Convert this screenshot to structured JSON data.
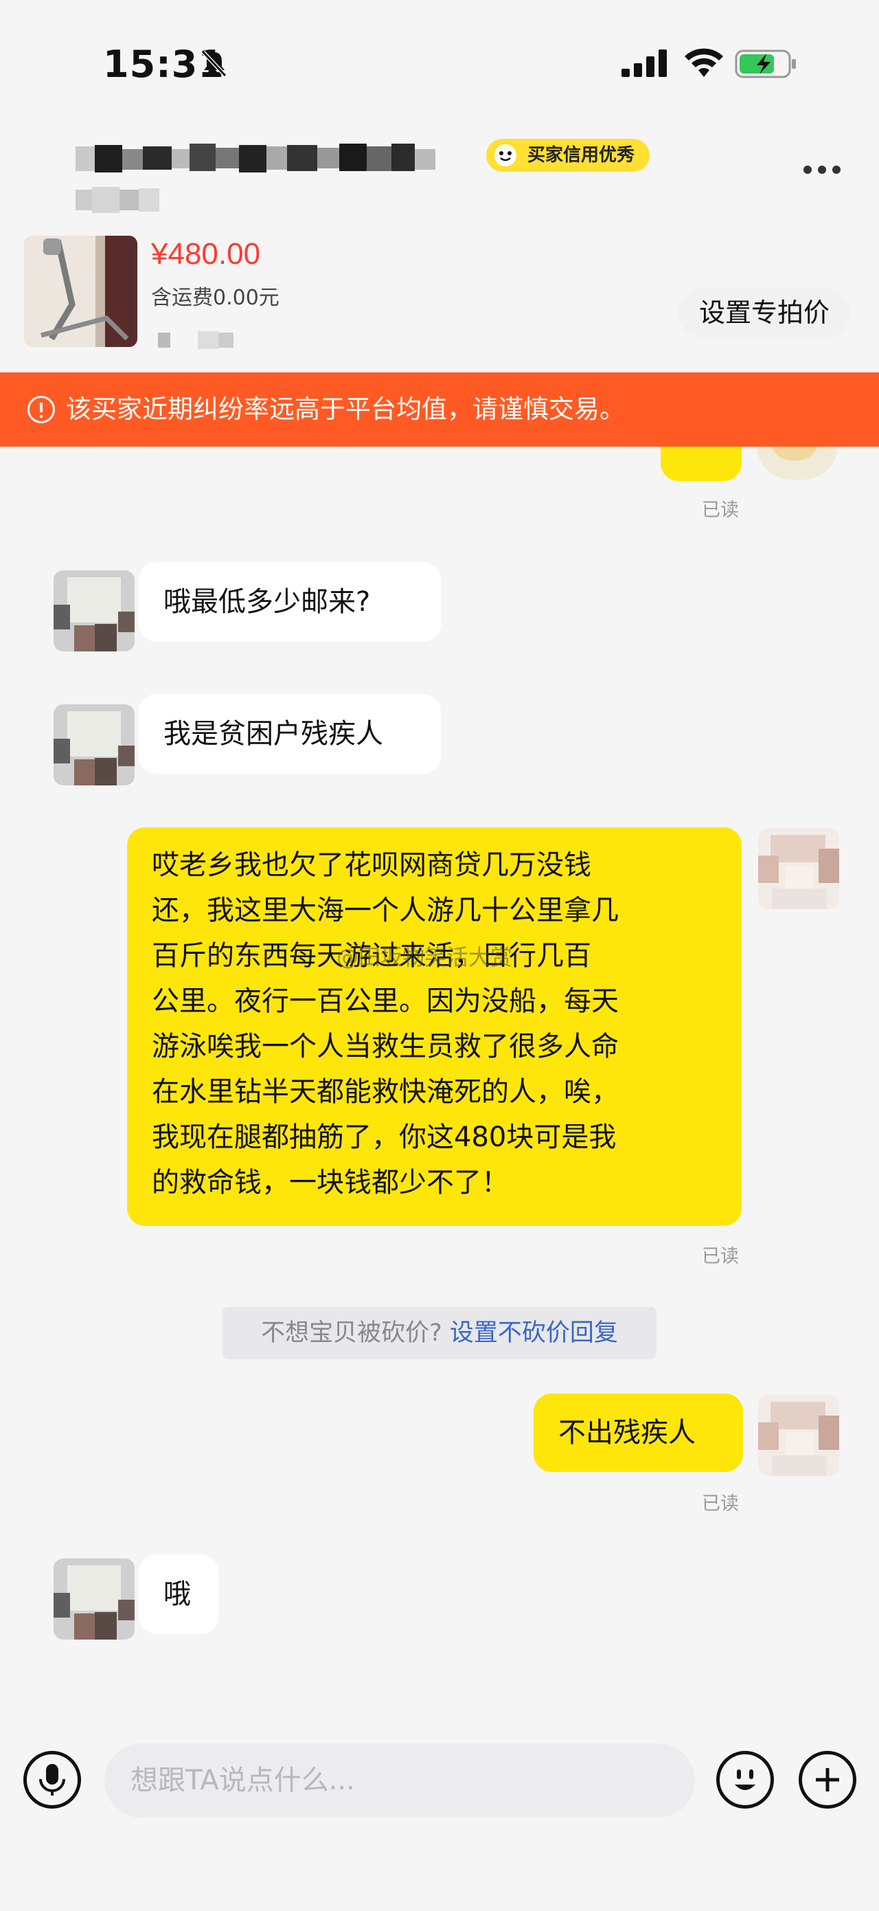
{
  "status_bar": {
    "time": "15:31"
  },
  "header": {
    "badge": "买家信用优秀"
  },
  "product": {
    "price": "¥480.00",
    "shipping": "含运费0.00元",
    "set_price_button": "设置专拍价"
  },
  "warning": {
    "text": "该买家近期纠纷率远高于平台均值，请谨慎交易。"
  },
  "messages": [
    {
      "from": "buyer",
      "text": "哦最低多少邮来?"
    },
    {
      "from": "buyer",
      "text": "我是贫困户残疾人"
    },
    {
      "from": "seller",
      "lines": [
        "哎老乡我也欠了花呗网商贷几万没钱",
        "还，我这里大海一个人游几十公里拿几",
        "百斤的东西每天游过来活，日行几百",
        "公里。夜行一百公里。因为没船，每天",
        "游泳唉我一个人当救生员救了很多人命",
        "在水里钻半天都能救快淹死的人，唉，",
        "我现在腿都抽筋了，你这480块可是我",
        "的救命钱，一块钱都少不了！"
      ],
      "status": "已读"
    },
    {
      "from": "seller",
      "text": "不出残疾人",
      "status": "已读"
    },
    {
      "from": "buyer",
      "text": "哦"
    }
  ],
  "read_label_top": "已读",
  "system_tip": {
    "text": "不想宝贝被砍价?",
    "link": "设置不砍价回复"
  },
  "watermark": "@田坂物笑活大赏",
  "input_bar": {
    "placeholder": "想跟TA说点什么..."
  },
  "colors": {
    "accent_yellow": "#ffe60a",
    "warning": "#ff5a23",
    "price": "#ff3b30",
    "link": "#3a66c8"
  }
}
